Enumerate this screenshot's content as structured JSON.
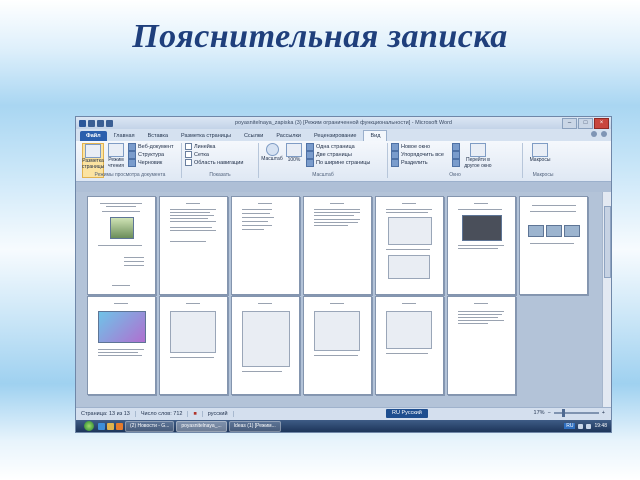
{
  "slide": {
    "title": "Пояснительная записка"
  },
  "window": {
    "title": "poyasnitelnaya_zapiska (3) [Режим ограниченной функциональности] - Microsoft Word",
    "controls": [
      "–",
      "□",
      "×"
    ]
  },
  "tabs": [
    {
      "label": "Файл",
      "kind": "file"
    },
    {
      "label": "Главная"
    },
    {
      "label": "Вставка"
    },
    {
      "label": "Разметка страницы"
    },
    {
      "label": "Ссылки"
    },
    {
      "label": "Рассылки"
    },
    {
      "label": "Рецензирование"
    },
    {
      "label": "Вид",
      "kind": "active"
    }
  ],
  "ribbon": {
    "views": {
      "name": "Режимы просмотра документа",
      "layout": "Разметка страницы",
      "reading": "Режим чтения",
      "web": "Веб-документ",
      "outline": "Структура",
      "draft": "Черновик"
    },
    "show": {
      "name": "Показать",
      "ruler": "Линейка",
      "grid": "Сетка",
      "nav": "Область навигации"
    },
    "zoom": {
      "name": "Масштаб",
      "zoom": "Масштаб",
      "pct": "100%",
      "one": "Одна страница",
      "two": "Две страницы",
      "width": "По ширине страницы"
    },
    "window": {
      "name": "Окно",
      "newwin": "Новое окно",
      "arrange": "Упорядочить все",
      "split": "Разделить",
      "switch": "Перейти в другое окно"
    },
    "macros": {
      "name": "Макросы",
      "btn": "Макросы"
    }
  },
  "status": {
    "page": "Страница: 13 из 13",
    "words": "Число слов: 712",
    "lang": "русский",
    "lang_indicator": "RU Русский",
    "zoom": "17%",
    "zoom_level": 0.17
  },
  "taskbar": {
    "tasks": [
      "(2) Новости - G...",
      "poyasnitelnaya_...",
      "Ideas (1) [Режим..."
    ],
    "lang": "RU",
    "time": "19:48"
  }
}
